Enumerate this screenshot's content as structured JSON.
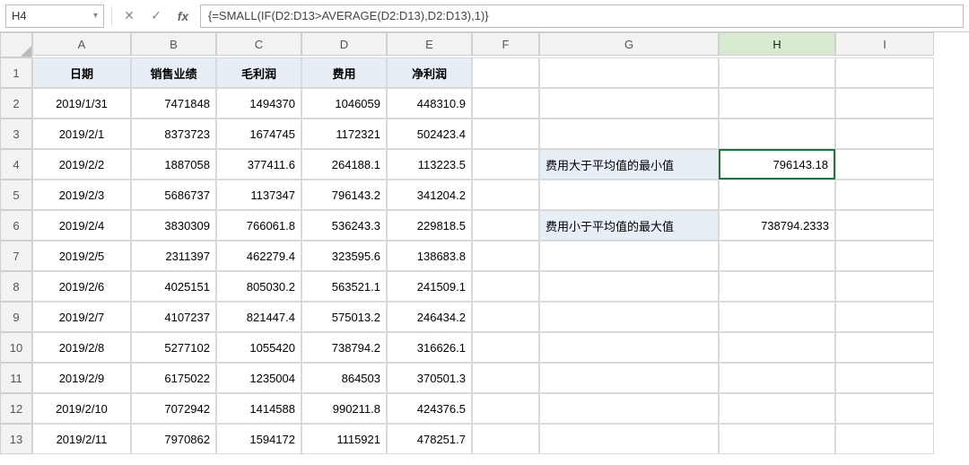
{
  "namebox": "H4",
  "formula": "{=SMALL(IF(D2:D13>AVERAGE(D2:D13),D2:D13),1)}",
  "colHeaders": [
    "A",
    "B",
    "C",
    "D",
    "E",
    "F",
    "G",
    "H",
    "I"
  ],
  "rowHeaders": [
    "1",
    "2",
    "3",
    "4",
    "5",
    "6",
    "7",
    "8",
    "9",
    "10",
    "11",
    "12",
    "13"
  ],
  "table": {
    "headers": [
      "日期",
      "销售业绩",
      "毛利润",
      "费用",
      "净利润"
    ],
    "rows": [
      [
        "2019/1/31",
        "7471848",
        "1494370",
        "1046059",
        "448310.9"
      ],
      [
        "2019/2/1",
        "8373723",
        "1674745",
        "1172321",
        "502423.4"
      ],
      [
        "2019/2/2",
        "1887058",
        "377411.6",
        "264188.1",
        "113223.5"
      ],
      [
        "2019/2/3",
        "5686737",
        "1137347",
        "796143.2",
        "341204.2"
      ],
      [
        "2019/2/4",
        "3830309",
        "766061.8",
        "536243.3",
        "229818.5"
      ],
      [
        "2019/2/5",
        "2311397",
        "462279.4",
        "323595.6",
        "138683.8"
      ],
      [
        "2019/2/6",
        "4025151",
        "805030.2",
        "563521.1",
        "241509.1"
      ],
      [
        "2019/2/7",
        "4107237",
        "821447.4",
        "575013.2",
        "246434.2"
      ],
      [
        "2019/2/8",
        "5277102",
        "1055420",
        "738794.2",
        "316626.1"
      ],
      [
        "2019/2/9",
        "6175022",
        "1235004",
        "864503",
        "370501.3"
      ],
      [
        "2019/2/10",
        "7072942",
        "1414588",
        "990211.8",
        "424376.5"
      ],
      [
        "2019/2/11",
        "7970862",
        "1594172",
        "1115921",
        "478251.7"
      ]
    ]
  },
  "side": {
    "label1": "费用大于平均值的最小值",
    "value1": "796143.18",
    "label2": "费用小于平均值的最大值",
    "value2": "738794.2333"
  },
  "chart_data": {
    "type": "table",
    "columns": [
      "日期",
      "销售业绩",
      "毛利润",
      "费用",
      "净利润"
    ],
    "rows": [
      [
        "2019/1/31",
        7471848,
        1494370,
        1046059,
        448310.9
      ],
      [
        "2019/2/1",
        8373723,
        1674745,
        1172321,
        502423.4
      ],
      [
        "2019/2/2",
        1887058,
        377411.6,
        264188.1,
        113223.5
      ],
      [
        "2019/2/3",
        5686737,
        1137347,
        796143.2,
        341204.2
      ],
      [
        "2019/2/4",
        3830309,
        766061.8,
        536243.3,
        229818.5
      ],
      [
        "2019/2/5",
        2311397,
        462279.4,
        323595.6,
        138683.8
      ],
      [
        "2019/2/6",
        4025151,
        805030.2,
        563521.1,
        241509.1
      ],
      [
        "2019/2/7",
        4107237,
        821447.4,
        575013.2,
        246434.2
      ],
      [
        "2019/2/8",
        5277102,
        1055420,
        738794.2,
        316626.1
      ],
      [
        "2019/2/9",
        6175022,
        1235004,
        864503,
        370501.3
      ],
      [
        "2019/2/10",
        7072942,
        1414588,
        990211.8,
        424376.5
      ],
      [
        "2019/2/11",
        7970862,
        1594172,
        1115921,
        478251.7
      ]
    ],
    "computed": {
      "费用大于平均值的最小值": 796143.18,
      "费用小于平均值的最大值": 738794.2333
    }
  }
}
